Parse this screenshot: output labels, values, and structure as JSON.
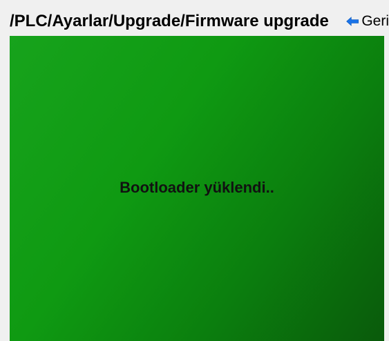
{
  "header": {
    "path": "/PLC/Ayarlar/Upgrade/Firmware upgrade",
    "back_label": "Geri",
    "back_icon": "left-arrow-icon"
  },
  "status": {
    "message": "Bootloader yüklendi..",
    "panel_color": "#0f9a12"
  },
  "colors": {
    "arrow": "#1a73e8",
    "background": "#f0f0f0"
  }
}
